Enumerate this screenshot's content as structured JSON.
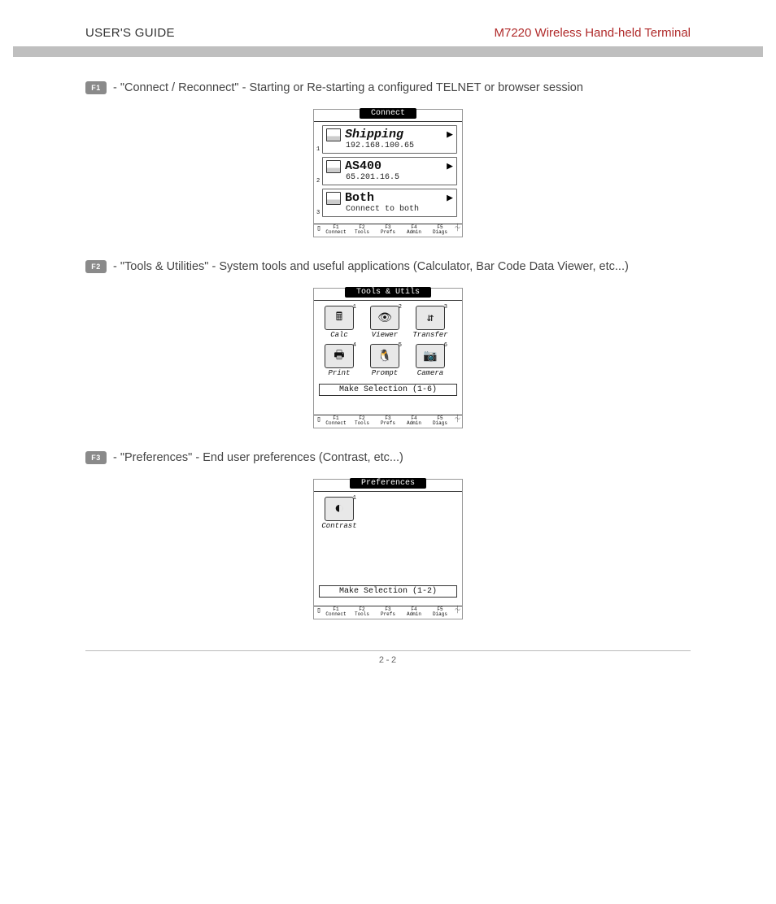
{
  "header": {
    "left": "USER'S GUIDE",
    "right": "M7220 Wireless Hand-held Terminal"
  },
  "items": [
    {
      "key": "F1",
      "text": "- \"Connect / Reconnect\" - Starting or Re-starting a configured TELNET or browser session"
    },
    {
      "key": "F2",
      "text": "- \"Tools & Utilities\" - System tools and useful applications (Calculator, Bar Code Data Viewer, etc...)"
    },
    {
      "key": "F3",
      "text": "- \"Preferences\" - End user preferences (Contrast, etc...)"
    }
  ],
  "screens": {
    "connect": {
      "title": "Connect",
      "rows": [
        {
          "num": "1",
          "name": "Shipping",
          "sub": "192.168.100.65"
        },
        {
          "num": "2",
          "name": "AS400",
          "sub": "65.201.16.5"
        },
        {
          "num": "3",
          "name": "Both",
          "sub": "Connect to both"
        }
      ]
    },
    "tools": {
      "title": "Tools & Utils",
      "apps": [
        {
          "n": "1",
          "label": "Calc",
          "glyph": "🖩"
        },
        {
          "n": "2",
          "label": "Viewer",
          "glyph": "👁"
        },
        {
          "n": "3",
          "label": "Transfer",
          "glyph": "⇵"
        },
        {
          "n": "4",
          "label": "Print",
          "glyph": "🖶"
        },
        {
          "n": "5",
          "label": "Prompt",
          "glyph": "🐧"
        },
        {
          "n": "6",
          "label": "Camera",
          "glyph": "📷"
        }
      ],
      "selection": "Make Selection (1-6)"
    },
    "prefs": {
      "title": "Preferences",
      "apps": [
        {
          "n": "1",
          "label": "Contrast",
          "glyph": "◐"
        }
      ],
      "selection": "Make Selection (1-2)"
    },
    "softkeys": [
      {
        "f": "F1",
        "label": "Connect"
      },
      {
        "f": "F2",
        "label": "Tools"
      },
      {
        "f": "F3",
        "label": "Prefs"
      },
      {
        "f": "F4",
        "label": "Admin"
      },
      {
        "f": "F5",
        "label": "Diags"
      }
    ]
  },
  "page_number": "2-2"
}
